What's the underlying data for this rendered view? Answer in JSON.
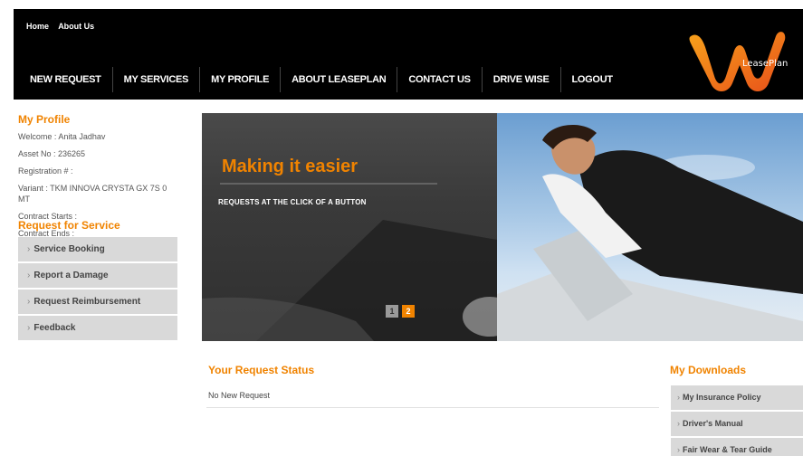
{
  "header": {
    "top_links": [
      "Home",
      "About Us"
    ],
    "nav": [
      "NEW REQUEST",
      "MY SERVICES",
      "MY PROFILE",
      "ABOUT LEASEPLAN",
      "CONTACT US",
      "DRIVE WISE",
      "LOGOUT"
    ],
    "logo_text": "LeasePlan"
  },
  "profile": {
    "title": "My Profile",
    "welcome": "Welcome : Anita Jadhav",
    "asset_no": "Asset No : 236265",
    "registration": "Registration # :",
    "variant": "Variant : TKM INNOVA CRYSTA GX 7S 0 MT",
    "contract_starts": "Contract Starts :",
    "contract_ends": "Contract Ends :"
  },
  "request_service": {
    "title": "Request for Service",
    "items": [
      "Service Booking",
      "Report a Damage",
      "Request Reimbursement",
      "Feedback"
    ]
  },
  "banner": {
    "heading": "Making it easier",
    "subheading": "REQUESTS AT THE CLICK OF A BUTTON",
    "slides": [
      "1",
      "2"
    ],
    "active_slide": "2"
  },
  "status": {
    "title": "Your Request Status",
    "message": "No New Request"
  },
  "downloads": {
    "title": "My Downloads",
    "items": [
      "My Insurance Policy",
      "Driver's Manual",
      "Fair Wear & Tear Guide"
    ]
  },
  "colors": {
    "accent": "#f08300",
    "header_bg": "#000000",
    "menu_bg": "#d9d9d9"
  }
}
